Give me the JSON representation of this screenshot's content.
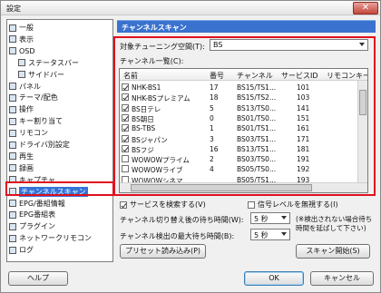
{
  "window": {
    "title": "設定",
    "close_glyph": "✕"
  },
  "tree": {
    "items": [
      {
        "label": "一般",
        "icon": "general-icon",
        "child": false
      },
      {
        "label": "表示",
        "icon": "display-icon",
        "child": false
      },
      {
        "label": "OSD",
        "icon": "osd-icon",
        "child": false
      },
      {
        "label": "ステータスバー",
        "icon": "statusbar-icon",
        "child": true
      },
      {
        "label": "サイドバー",
        "icon": "sidebar-icon",
        "child": true
      },
      {
        "label": "パネル",
        "icon": "panel-icon",
        "child": false
      },
      {
        "label": "テーマ/配色",
        "icon": "theme-icon",
        "child": false
      },
      {
        "label": "操作",
        "icon": "operation-icon",
        "child": false
      },
      {
        "label": "キー割り当て",
        "icon": "key-icon",
        "child": false
      },
      {
        "label": "リモコン",
        "icon": "remote-icon",
        "child": false
      },
      {
        "label": "ドライバ別設定",
        "icon": "driver-icon",
        "child": false
      },
      {
        "label": "再生",
        "icon": "play-icon",
        "child": false
      },
      {
        "label": "録画",
        "icon": "record-icon",
        "child": false
      },
      {
        "label": "キャプチャ",
        "icon": "capture-icon",
        "child": false
      },
      {
        "label": "チャンネルスキャン",
        "icon": "scan-icon",
        "child": false,
        "selected": true
      },
      {
        "label": "EPG/番組情報",
        "icon": "epg-icon",
        "child": false
      },
      {
        "label": "EPG番組表",
        "icon": "epg-table-icon",
        "child": false
      },
      {
        "label": "プラグイン",
        "icon": "plugin-icon",
        "child": false
      },
      {
        "label": "ネットワークリモコン",
        "icon": "network-remote-icon",
        "child": false
      },
      {
        "label": "ログ",
        "icon": "log-icon",
        "child": false
      }
    ]
  },
  "panel": {
    "header": "チャンネルスキャン",
    "tuning_space_label": "対象チューニング空間(T):",
    "tuning_space_value": "BS",
    "channel_list_label": "チャンネル一覧(C):",
    "columns": [
      "名前",
      "番号",
      "チャンネル",
      "サービスID",
      "リモコンキー"
    ],
    "rows": [
      {
        "checked": true,
        "name": "NHK-BS1",
        "num": "17",
        "ch": "BS15/TS1...",
        "sid": "101"
      },
      {
        "checked": true,
        "name": "NHK-BSプレミアム",
        "num": "18",
        "ch": "BS15/TS2...",
        "sid": "103"
      },
      {
        "checked": true,
        "name": "BS日テレ",
        "num": "5",
        "ch": "BS13/TS0...",
        "sid": "141"
      },
      {
        "checked": true,
        "name": "BS朝日",
        "num": "0",
        "ch": "BS01/TS0...",
        "sid": "151"
      },
      {
        "checked": true,
        "name": "BS-TBS",
        "num": "1",
        "ch": "BS01/TS1...",
        "sid": "161"
      },
      {
        "checked": true,
        "name": "BSジャパン",
        "num": "3",
        "ch": "BS03/TS1...",
        "sid": "171"
      },
      {
        "checked": true,
        "name": "BSフジ",
        "num": "16",
        "ch": "BS13/TS1...",
        "sid": "181"
      },
      {
        "checked": false,
        "name": "WOWOWプライム",
        "num": "2",
        "ch": "BS03/TS0...",
        "sid": "191"
      },
      {
        "checked": false,
        "name": "WOWOWライブ",
        "num": "4",
        "ch": "BS05/TS0...",
        "sid": "192"
      },
      {
        "checked": false,
        "name": "WOWOWシネマ",
        "num": "",
        "ch": "BS05/TS1...",
        "sid": "193"
      }
    ],
    "search_service_label": "サービスを検索する(V)",
    "ignore_signal_label": "信号レベルを無視する(I)",
    "wait_time_label": "チャンネル切り替え後の待ち時間(W):",
    "wait_time_value": "5 秒",
    "max_wait_label": "チャンネル検出の最大待ち時間(B):",
    "max_wait_value": "5 秒",
    "note": "(※検出されない場合待ち時間を延ばして下さい)",
    "preset_button": "プリセット読み込み(P)",
    "scan_button": "スキャン開始(S)"
  },
  "footer": {
    "help": "ヘルプ",
    "ok": "OK",
    "cancel": "キャンセル"
  }
}
